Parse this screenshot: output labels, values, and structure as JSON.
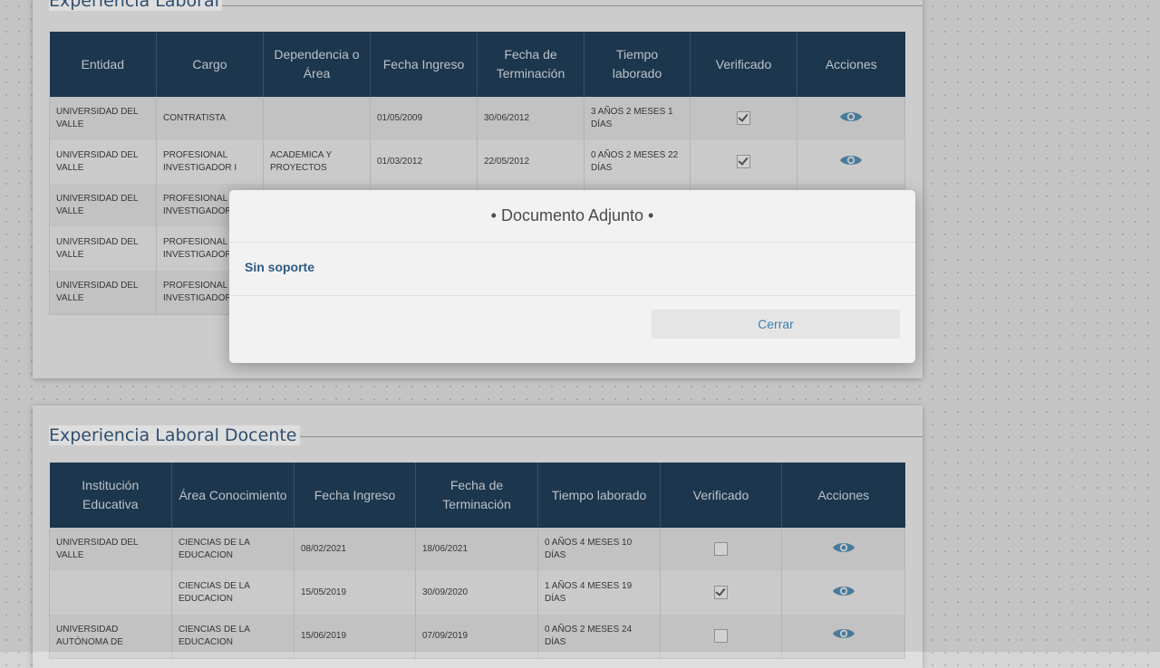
{
  "laboral": {
    "title": "Experiencia Laboral",
    "headers": [
      "Entidad",
      "Cargo",
      "Dependencia o Área",
      "Fecha Ingreso",
      "Fecha de Terminación",
      "Tiempo laborado",
      "Verificado",
      "Acciones"
    ],
    "rows": [
      {
        "entidad": "UNIVERSIDAD DEL VALLE",
        "cargo": "CONTRATISTA",
        "dependencia": "",
        "ingreso": "01/05/2009",
        "terminacion": "30/06/2012",
        "tiempo": "3 AÑOS 2 MESES 1 DÍAS",
        "verificado": true
      },
      {
        "entidad": "UNIVERSIDAD DEL VALLE",
        "cargo": "PROFESIONAL INVESTIGADOR I",
        "dependencia": "ACADEMICA Y PROYECTOS",
        "ingreso": "01/03/2012",
        "terminacion": "22/05/2012",
        "tiempo": "0 AÑOS 2 MESES 22 DÍAS",
        "verificado": true
      },
      {
        "entidad": "UNIVERSIDAD DEL VALLE",
        "cargo": "PROFESIONAL INVESTIGADOR",
        "dependencia": "",
        "ingreso": "",
        "terminacion": "",
        "tiempo": "",
        "verificado": null
      },
      {
        "entidad": "UNIVERSIDAD DEL VALLE",
        "cargo": "PROFESIONAL INVESTIGADOR",
        "dependencia": "",
        "ingreso": "",
        "terminacion": "",
        "tiempo": "",
        "verificado": null
      },
      {
        "entidad": "UNIVERSIDAD DEL VALLE",
        "cargo": "PROFESIONAL INVESTIGADOR",
        "dependencia": "",
        "ingreso": "",
        "terminacion": "",
        "tiempo": "",
        "verificado": null
      }
    ]
  },
  "docente": {
    "title": "Experiencia Laboral Docente",
    "headers": [
      "Institución Educativa",
      "Área Conocimiento",
      "Fecha Ingreso",
      "Fecha de Terminación",
      "Tiempo laborado",
      "Verificado",
      "Acciones"
    ],
    "rows": [
      {
        "institucion": "UNIVERSIDAD DEL VALLE",
        "area": "CIENCIAS DE LA EDUCACION",
        "ingreso": "08/02/2021",
        "terminacion": "18/06/2021",
        "tiempo": "0 AÑOS 4 MESES 10 DÍAS",
        "verificado": false
      },
      {
        "institucion": "",
        "area": "CIENCIAS DE LA EDUCACION",
        "ingreso": "15/05/2019",
        "terminacion": "30/09/2020",
        "tiempo": "1 AÑOS 4 MESES 19 DÍAS",
        "verificado": true
      },
      {
        "institucion": "UNIVERSIDAD AUTÓNOMA DE",
        "area": "CIENCIAS DE LA EDUCACION",
        "ingreso": "15/06/2019",
        "terminacion": "07/09/2019",
        "tiempo": "0 AÑOS 2 MESES 24 DÍAS",
        "verificado": false
      }
    ]
  },
  "modal": {
    "title": "• Documento Adjunto •",
    "body": "Sin soporte",
    "close_label": "Cerrar"
  },
  "colors": {
    "header_bg": "#1f3b54",
    "title": "#2f4f6e",
    "eye_icon": "#4f86a8",
    "link": "#3d7fad"
  },
  "icons": {
    "action": "eye-icon",
    "verified": "checkbox-icon"
  }
}
